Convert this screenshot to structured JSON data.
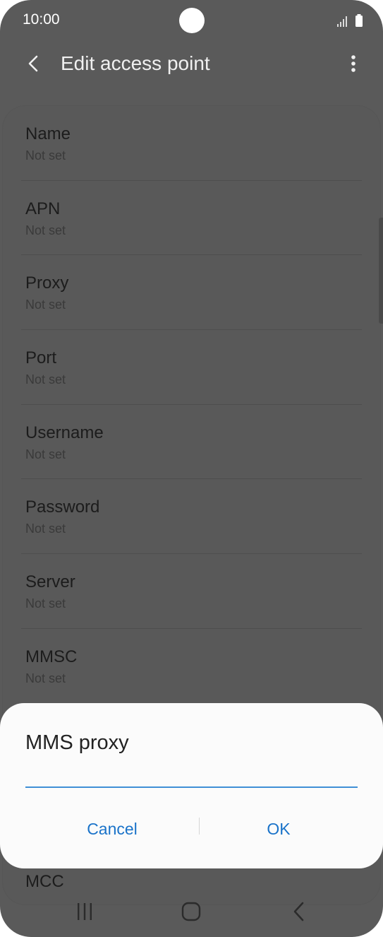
{
  "status_bar": {
    "time": "10:00"
  },
  "header": {
    "title": "Edit access point"
  },
  "fields": [
    {
      "label": "Name",
      "value": "Not set"
    },
    {
      "label": "APN",
      "value": "Not set"
    },
    {
      "label": "Proxy",
      "value": "Not set"
    },
    {
      "label": "Port",
      "value": "Not set"
    },
    {
      "label": "Username",
      "value": "Not set"
    },
    {
      "label": "Password",
      "value": "Not set"
    },
    {
      "label": "Server",
      "value": "Not set"
    },
    {
      "label": "MMSC",
      "value": "Not set"
    }
  ],
  "partial_row": {
    "label": "MCC"
  },
  "dialog": {
    "title": "MMS proxy",
    "input_value": "",
    "cancel_label": "Cancel",
    "ok_label": "OK"
  },
  "colors": {
    "accent": "#1a73c9",
    "input_underline": "#3f8fd6",
    "dim_background": "#5a5a5a"
  },
  "icons": {
    "back": "back-arrow-icon",
    "more": "more-vertical-icon",
    "nav_recents": "recents-icon",
    "nav_home": "home-icon",
    "nav_back": "nav-back-icon"
  }
}
